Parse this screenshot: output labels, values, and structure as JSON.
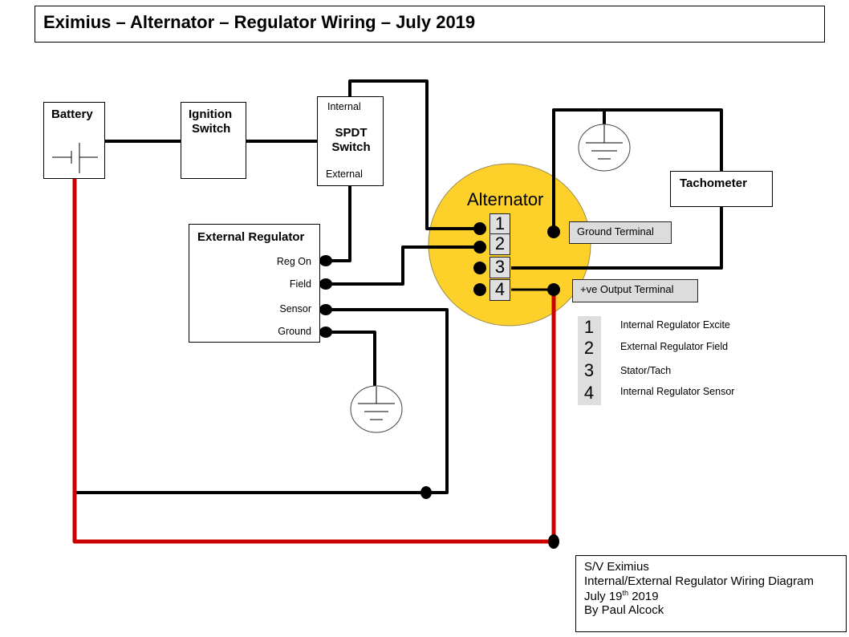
{
  "title": "Eximius – Alternator – Regulator Wiring – July 2019",
  "colors": {
    "alternator_fill": "#FDD12A",
    "positive_wire": "#CC0000",
    "wire": "#000000",
    "label_fill": "#DCDCDC"
  },
  "components": {
    "battery": {
      "label": "Battery",
      "icon": "battery-symbol-icon"
    },
    "ignition_switch": {
      "label_line1": "Ignition",
      "label_line2": "Switch"
    },
    "spdt_switch": {
      "label_line1": "SPDT",
      "label_line2": "Switch",
      "top_terminal": "Internal",
      "bottom_terminal": "External"
    },
    "external_regulator": {
      "label": "External Regulator",
      "terminals": [
        "Reg On",
        "Field",
        "Sensor",
        "Ground"
      ]
    },
    "alternator": {
      "label": "Alternator",
      "pins": [
        "1",
        "2",
        "3",
        "4"
      ],
      "ground_terminal_label": "Ground Terminal",
      "output_terminal_label": "+ve Output Terminal"
    },
    "tachometer": {
      "label": "Tachometer"
    },
    "grounds": [
      "ground-symbol-icon",
      "ground-symbol-icon"
    ]
  },
  "legend": [
    {
      "num": "1",
      "text": "Internal Regulator Excite"
    },
    {
      "num": "2",
      "text": "External Regulator Field"
    },
    {
      "num": "3",
      "text": "Stator/Tach"
    },
    {
      "num": "4",
      "text": "Internal Regulator Sensor"
    }
  ],
  "note": {
    "line1": "S/V Eximius",
    "line2": "Internal/External Regulator Wiring Diagram",
    "line3_pre": "July 19",
    "line3_sup": "th",
    "line3_post": " 2019",
    "line4": "By Paul Alcock"
  }
}
